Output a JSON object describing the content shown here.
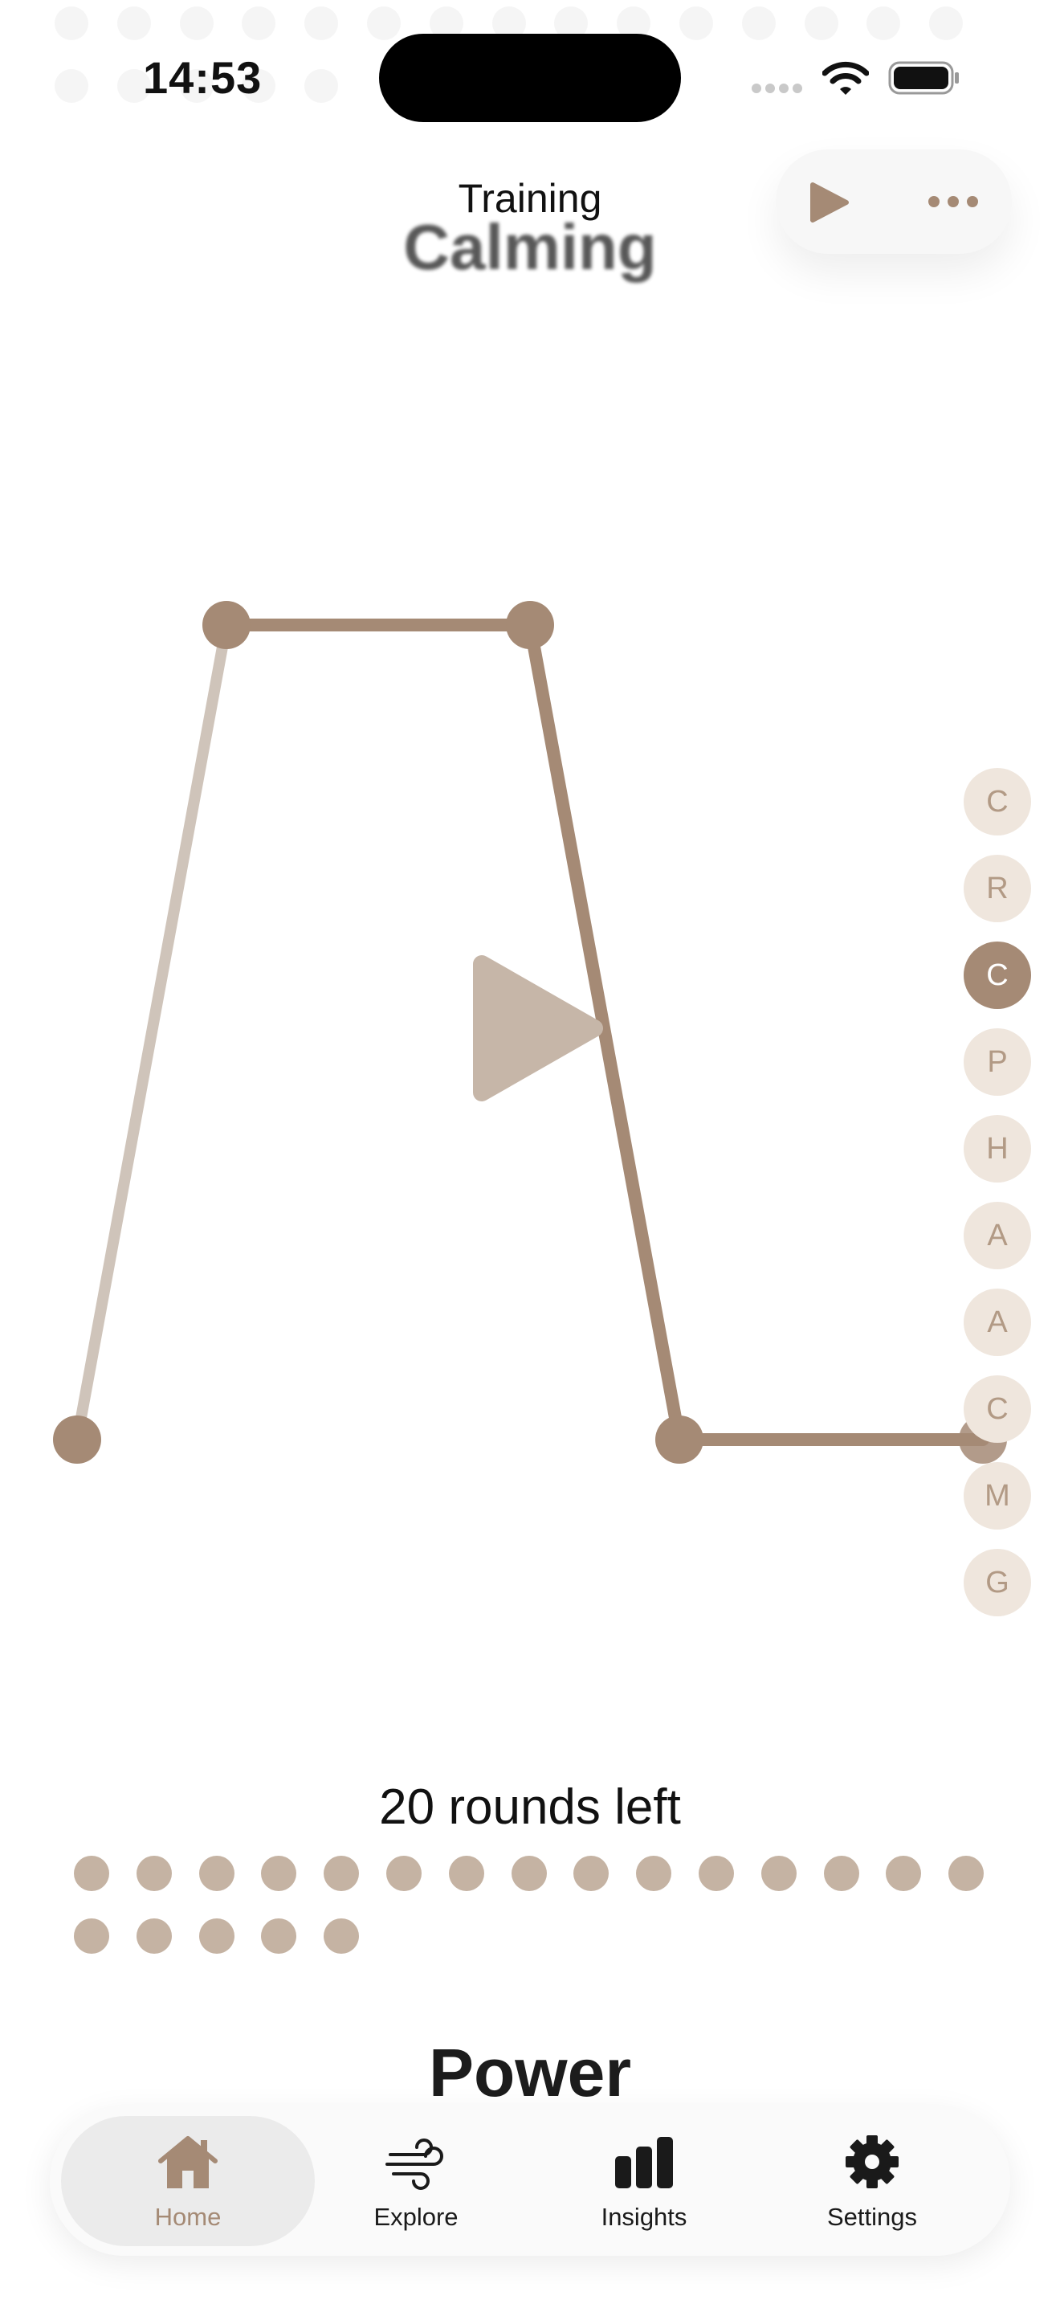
{
  "status_bar": {
    "time": "14:53"
  },
  "header": {
    "title": "Training",
    "subtitle": "Calming",
    "actions": {
      "play_icon": "play-icon",
      "more_icon": "more-icon"
    }
  },
  "side_index": {
    "items": [
      "C",
      "R",
      "C",
      "P",
      "H",
      "A",
      "A",
      "C",
      "M",
      "G"
    ],
    "active_index": 2
  },
  "rounds": {
    "label": "20 rounds left",
    "total": 20
  },
  "next_section": {
    "title": "Power"
  },
  "tab_bar": {
    "tabs": [
      {
        "label": "Home",
        "icon": "home-icon",
        "active": true
      },
      {
        "label": "Explore",
        "icon": "wind-icon",
        "active": false
      },
      {
        "label": "Insights",
        "icon": "bar-chart-icon",
        "active": false
      },
      {
        "label": "Settings",
        "icon": "gear-icon",
        "active": false
      }
    ]
  },
  "colors": {
    "accent": "#a58a75",
    "accent_light": "#cfc4ba",
    "chip_bg": "#efe6dd",
    "round_dot": "#c5b3a3",
    "play_overlay": "#c6b6a8"
  }
}
